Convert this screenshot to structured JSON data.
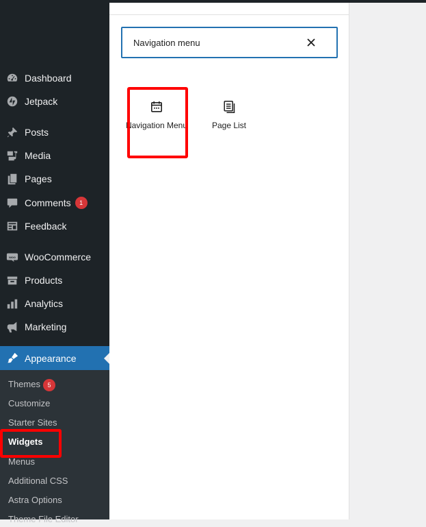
{
  "sidebar": {
    "items": [
      {
        "label": "Dashboard",
        "icon": "dashboard-icon"
      },
      {
        "label": "Jetpack",
        "icon": "jetpack-icon"
      },
      {
        "label": "Posts",
        "icon": "pushpin-icon"
      },
      {
        "label": "Media",
        "icon": "media-icon"
      },
      {
        "label": "Pages",
        "icon": "pages-icon"
      },
      {
        "label": "Comments",
        "icon": "comment-icon",
        "badge": "1"
      },
      {
        "label": "Feedback",
        "icon": "feedback-icon"
      },
      {
        "label": "WooCommerce",
        "icon": "woocommerce-icon"
      },
      {
        "label": "Products",
        "icon": "archive-icon"
      },
      {
        "label": "Analytics",
        "icon": "bar-chart-icon"
      },
      {
        "label": "Marketing",
        "icon": "megaphone-icon"
      },
      {
        "label": "Appearance",
        "icon": "paintbrush-icon",
        "current": true
      }
    ],
    "submenu": [
      {
        "label": "Themes",
        "badge": "5"
      },
      {
        "label": "Customize"
      },
      {
        "label": "Starter Sites"
      },
      {
        "label": "Widgets",
        "current": true
      },
      {
        "label": "Menus"
      },
      {
        "label": "Additional CSS"
      },
      {
        "label": "Astra Options"
      },
      {
        "label": "Theme File Editor"
      }
    ]
  },
  "inserter": {
    "search_value": "Navigation menu",
    "blocks": [
      {
        "label": "Navigation Menu",
        "icon": "navigation-icon"
      },
      {
        "label": "Page List",
        "icon": "page-list-icon"
      }
    ]
  },
  "colors": {
    "sidebar_bg": "#1d2327",
    "accent": "#2271b1",
    "badge": "#d63638",
    "highlight": "#ff0000"
  }
}
